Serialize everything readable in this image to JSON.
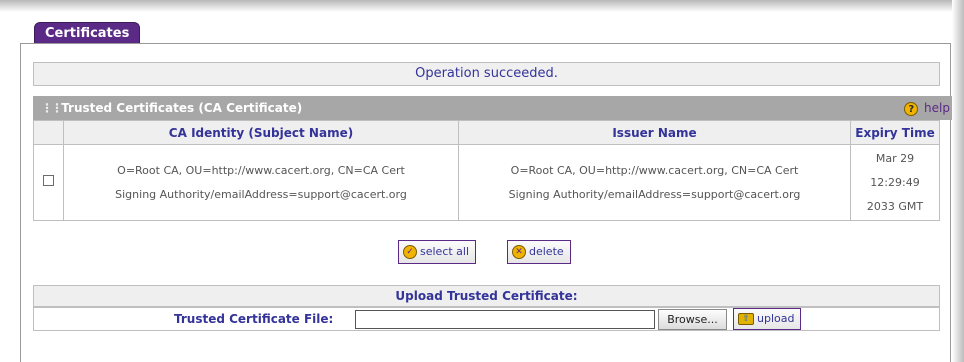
{
  "tab": {
    "label": "Certificates"
  },
  "status": {
    "message": "Operation succeeded."
  },
  "section": {
    "title": "Trusted Certificates (CA Certificate)",
    "help_label": "help",
    "help_icon": "help-icon"
  },
  "table": {
    "headers": [
      "",
      "CA Identity (Subject Name)",
      "Issuer Name",
      "Expiry Time"
    ],
    "rows": [
      {
        "selected": false,
        "identity_line1": "O=Root CA, OU=http://www.cacert.org, CN=CA Cert",
        "identity_line2": "Signing Authority/emailAddress=support@cacert.org",
        "issuer_line1": "O=Root CA, OU=http://www.cacert.org, CN=CA Cert",
        "issuer_line2": "Signing Authority/emailAddress=support@cacert.org",
        "expiry_line1": "Mar 29",
        "expiry_line2": "12:29:49",
        "expiry_line3": "2033 GMT"
      }
    ]
  },
  "buttons": {
    "select_all": "select all",
    "delete": "delete",
    "upload": "upload",
    "browse": "Browse..."
  },
  "upload": {
    "title": "Upload Trusted Certificate:",
    "file_label": "Trusted Certificate File:",
    "file_value": ""
  },
  "colors": {
    "accent": "#5b2a86",
    "header_text": "#333399",
    "section_bar": "#a7a7a7"
  }
}
